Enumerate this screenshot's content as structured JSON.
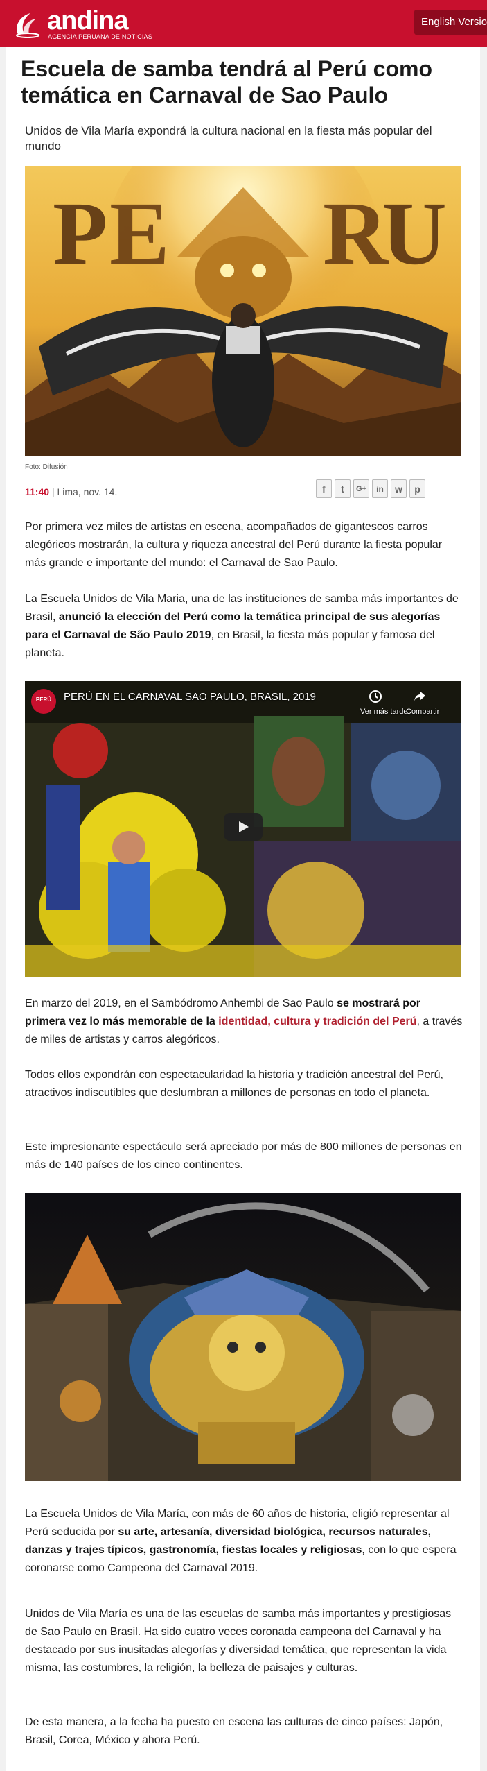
{
  "header": {
    "logo_text": "andina",
    "logo_subtitle": "AGENCIA PERUANA DE NOTICIAS",
    "language_button": "English Version"
  },
  "article": {
    "title": "Escuela de samba tendrá al Perú como temática en Carnaval de Sao Paulo",
    "subtitle": "Unidos de Vila María expondrá la cultura nacional en la fiesta más popular del mundo",
    "photo_credit": "Foto: Difusión",
    "time": "11:40",
    "place_date": " | Lima, nov. 14.",
    "share_icons": [
      "facebook-icon",
      "twitter-icon",
      "google-plus-icon",
      "linkedin-icon",
      "whatsapp-icon",
      "print-icon"
    ],
    "share_glyphs": [
      "f",
      "t",
      "G+",
      "in",
      "w",
      "p"
    ],
    "image1_letters": "PE  RU",
    "p1": "Por primera vez miles de artistas en escena, acompañados de gigantescos carros alegóricos mostrarán, la cultura y riqueza ancestral del Perú durante la fiesta popular más grande e importante del mundo: el Carnaval de Sao Paulo.",
    "p2_a": "La Escuela Unidos de Vila Maria, una de las instituciones  de samba más importantes de Brasil, ",
    "p2_b": "anunció la elección del Perú como la temática principal de sus alegorías para el Carnaval de São Paulo 2019",
    "p2_c": ", en Brasil, la fiesta más popular y famosa del planeta.",
    "video": {
      "title": "PERÚ EN EL CARNAVAL SAO PAULO, BRASIL, 2019",
      "watch_later": "Ver más tarde",
      "share": "Compartir",
      "channel_badge": "PERÚ"
    },
    "p3_a": "En marzo del 2019, en el Sambódromo Anhembi de Sao Paulo ",
    "p3_b": "se mostrará por primera vez lo más memorable de la ",
    "p3_c": "identidad, cultura y tradición del Perú",
    "p3_d": ", a través de miles de artistas y carros alegóricos.",
    "p4": "Todos ellos expondrán con espectacularidad la historia y tradición ancestral del Perú, atractivos indiscutibles que deslumbran a millones de personas en todo el planeta.",
    "p5": "Este impresionante espectáculo será apreciado por más de 800 millones de personas en más de 140 países de los cinco continentes.",
    "p6_a": "La Escuela Unidos de Vila María, con más de 60 años de historia, eligió representar al Perú seducida por ",
    "p6_b": "su arte, artesanía, diversidad biológica, recursos naturales, danzas y trajes típicos, gastronomía, fiestas locales y religiosas",
    "p6_c": ", con lo que espera coronarse como Campeona del Carnaval 2019.",
    "p7": "Unidos de Vila María es una de las escuelas de samba más importantes y prestigiosas de Sao Paulo en Brasil. Ha sido cuatro veces coronada campeona del Carnaval y ha destacado por sus inusitadas alegorías y diversidad temática, que representan la vida misma, las costumbres, la religión, la belleza de paisajes y culturas.",
    "p8": "De esta manera, a la fecha ha puesto en escena las culturas de cinco países: Japón, Brasil, Corea, México y ahora Perú."
  },
  "colors": {
    "brand_red": "#c8102e",
    "link_red": "#b0202f"
  }
}
